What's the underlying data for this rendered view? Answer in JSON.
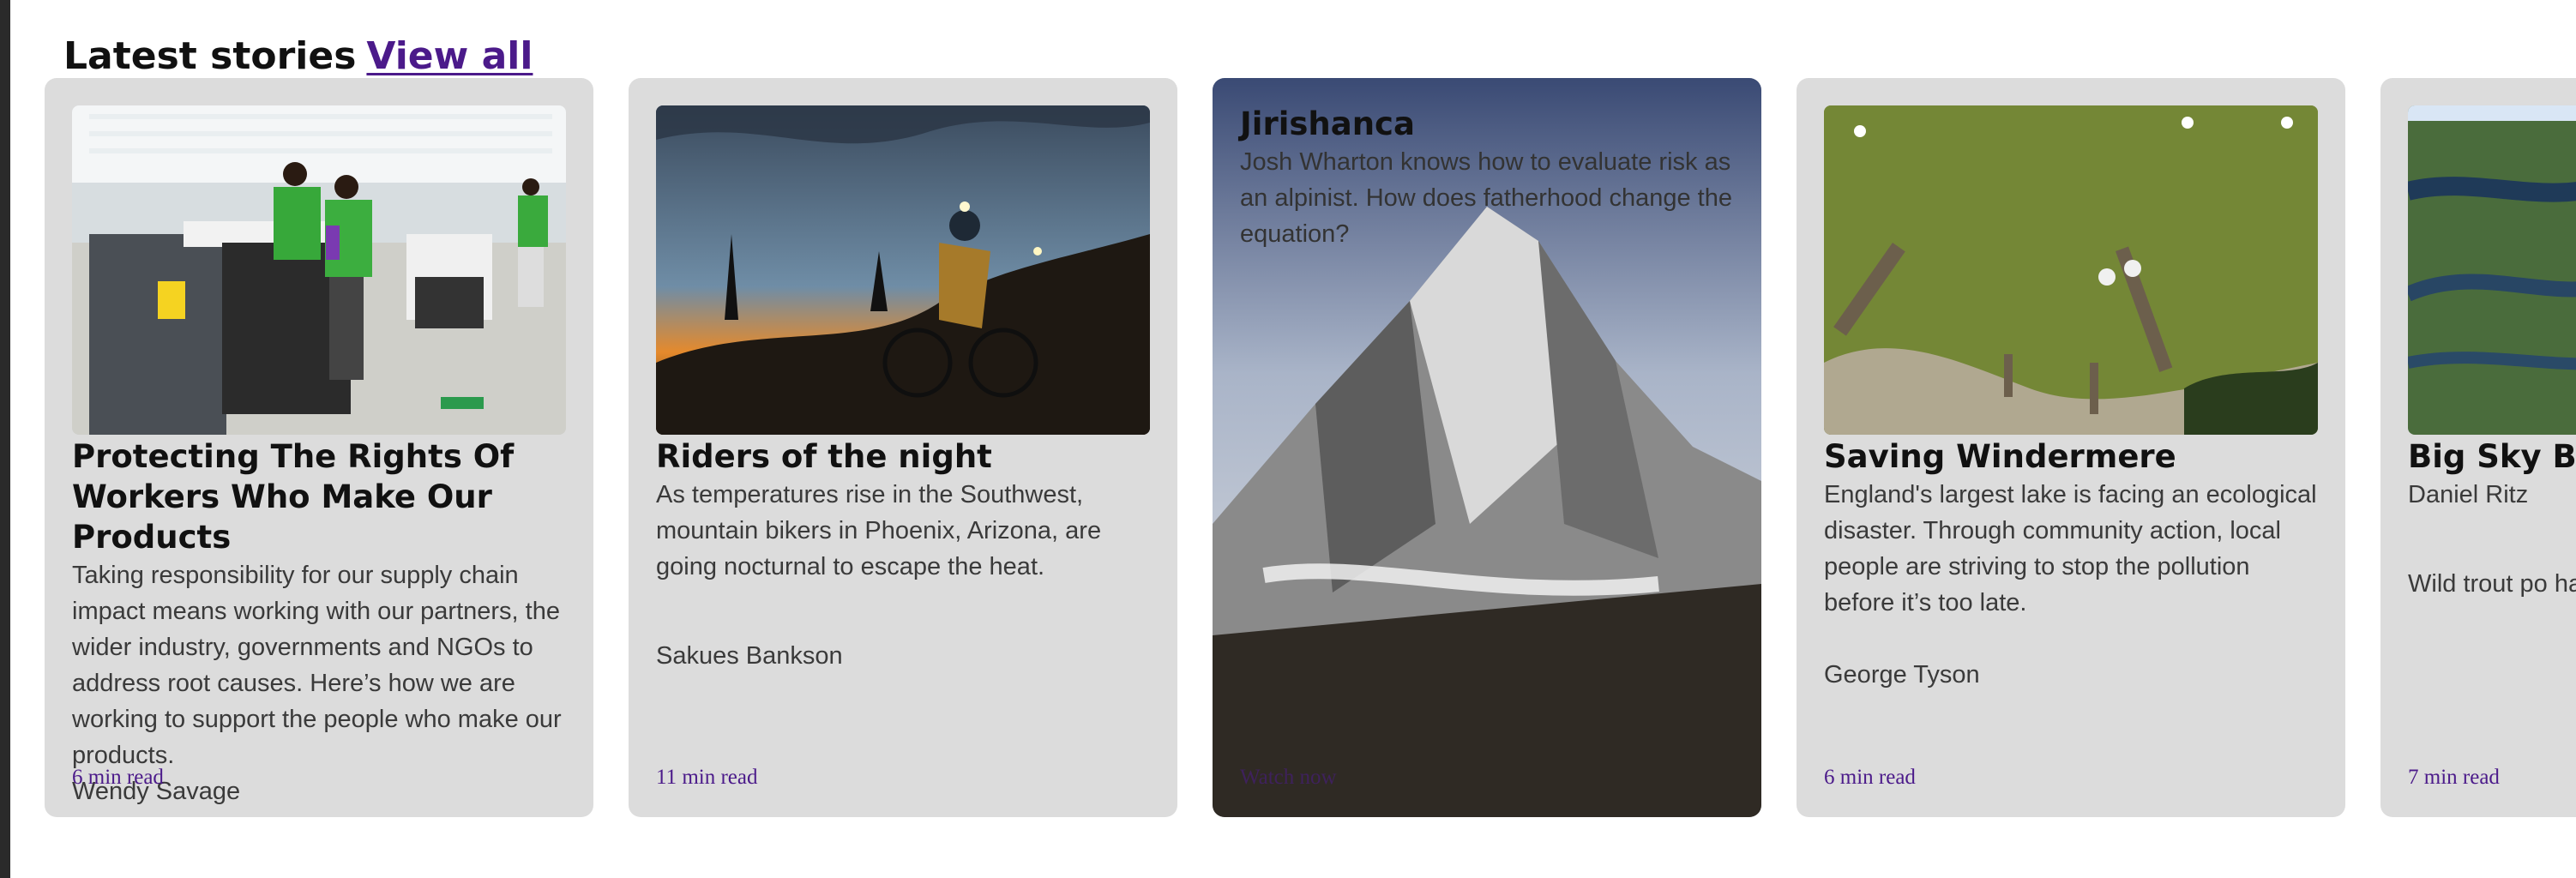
{
  "section": {
    "title": "Latest stories",
    "view_all": "View all"
  },
  "cards": [
    {
      "title": "Protecting The Rights Of Workers Who Make Our Products",
      "description": "Taking responsibility for our supply chain impact means working with our partners, the wider industry, governments and NGOs to address root causes. Here’s how we are working to support the people who make our products.",
      "author": "Wendy Savage",
      "read_time": "6 min read"
    },
    {
      "title": "Riders of the night",
      "description": "As temperatures rise in the Southwest, mountain bikers in Phoenix, Arizona, are going nocturnal to escape the heat.",
      "author": "Sakues Bankson",
      "read_time": "11 min read"
    },
    {
      "title": "Jirishanca",
      "description": "Josh Wharton knows how to evaluate risk as an alpinist. How does fatherhood change the equation?",
      "read_time": "Watch now"
    },
    {
      "title": "Saving Windermere",
      "description": "England's largest lake is facing an ecological disaster. Through community action, local people are striving to stop the pollution before it’s too late.",
      "author": "George Tyson",
      "read_time": "6 min read"
    },
    {
      "title": "Big Sky B",
      "author": "Daniel Ritz",
      "description": "Wild trout po have collaps enough is en",
      "read_time": "7 min read"
    }
  ],
  "colors": {
    "card_bg": "#dcdcdc",
    "link": "#4b1a8a"
  }
}
